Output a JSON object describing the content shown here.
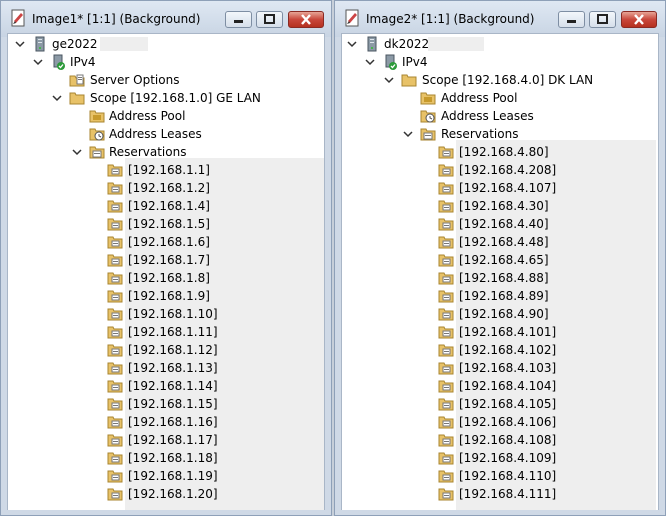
{
  "left": {
    "title": "Image1* [1:1] (Background)",
    "server": "ge2022",
    "ipv4": "IPv4",
    "server_options": "Server Options",
    "scope": "Scope [192.168.1.0] GE LAN",
    "address_pool": "Address Pool",
    "address_leases": "Address Leases",
    "reservations": "Reservations",
    "items": [
      "[192.168.1.1]",
      "[192.168.1.2]",
      "[192.168.1.4]",
      "[192.168.1.5]",
      "[192.168.1.6]",
      "[192.168.1.7]",
      "[192.168.1.8]",
      "[192.168.1.9]",
      "[192.168.1.10]",
      "[192.168.1.11]",
      "[192.168.1.12]",
      "[192.168.1.13]",
      "[192.168.1.14]",
      "[192.168.1.15]",
      "[192.168.1.16]",
      "[192.168.1.17]",
      "[192.168.1.18]",
      "[192.168.1.19]",
      "[192.168.1.20]"
    ]
  },
  "right": {
    "title": "Image2* [1:1] (Background)",
    "server": "dk2022",
    "ipv4": "IPv4",
    "scope": "Scope [192.168.4.0] DK LAN",
    "address_pool": "Address Pool",
    "address_leases": "Address Leases",
    "reservations": "Reservations",
    "items": [
      "[192.168.4.80]",
      "[192.168.4.208]",
      "[192.168.4.107]",
      "[192.168.4.30]",
      "[192.168.4.40]",
      "[192.168.4.48]",
      "[192.168.4.65]",
      "[192.168.4.88]",
      "[192.168.4.89]",
      "[192.168.4.90]",
      "[192.168.4.101]",
      "[192.168.4.102]",
      "[192.168.4.103]",
      "[192.168.4.104]",
      "[192.168.4.105]",
      "[192.168.4.106]",
      "[192.168.4.108]",
      "[192.168.4.109]",
      "[192.168.4.110]",
      "[192.168.4.111]"
    ]
  },
  "icons": {
    "title": "paint-document-icon",
    "server": "server-icon",
    "ipv4": "ipv4-network-icon",
    "folder": "folder-icon",
    "options": "server-options-icon",
    "pool": "address-pool-icon",
    "leases": "address-leases-icon",
    "reservations": "reservations-icon",
    "reservation": "reservation-icon"
  },
  "colors": {
    "frame": "#cfd9e6",
    "close_button": "#c9473b",
    "folder": "#e8c268"
  }
}
